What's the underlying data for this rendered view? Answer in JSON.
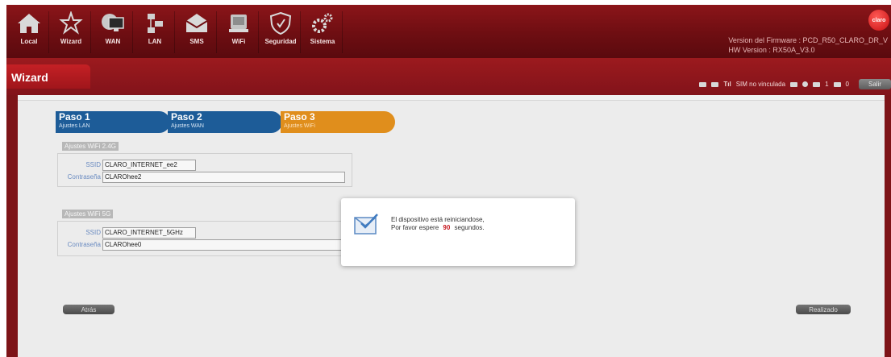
{
  "nav": {
    "items": [
      {
        "label": "Local",
        "icon": "home-icon"
      },
      {
        "label": "Wizard",
        "icon": "wizard-icon"
      },
      {
        "label": "WAN",
        "icon": "monitor-icon"
      },
      {
        "label": "LAN",
        "icon": "lan-icon"
      },
      {
        "label": "SMS",
        "icon": "envelope-icon"
      },
      {
        "label": "WiFi",
        "icon": "wifi-icon"
      },
      {
        "label": "Seguridad",
        "icon": "shield-icon"
      },
      {
        "label": "Sistema",
        "icon": "gears-icon"
      }
    ]
  },
  "header": {
    "firmware": "Version del Firmware : PCD_R50_CLARO_DR_V",
    "hw": "HW Version : RX50A_V3.0",
    "logo": "claro"
  },
  "titlebar": {
    "title": "Wizard",
    "sim_status": "SIM no vinculada",
    "count_a": "1",
    "count_b": "0",
    "logout": "Salir"
  },
  "steps": [
    {
      "title": "Paso 1",
      "subtitle": "Ajustes LAN"
    },
    {
      "title": "Paso 2",
      "subtitle": "Ajustes WAN"
    },
    {
      "title": "Paso 3",
      "subtitle": "Ajustes WiFi"
    }
  ],
  "wifi24": {
    "title": "Ajustes WiFi 2.4G",
    "ssid_label": "SSID",
    "ssid": "CLARO_INTERNET_ee2",
    "password_label": "Contraseña",
    "password": "CLAROhee2"
  },
  "wifi5": {
    "title": "Ajustes WiFi 5G",
    "ssid_label": "SSID",
    "ssid": "CLARO_INTERNET_5GHz",
    "password_label": "Contraseña",
    "password": "CLAROhee0"
  },
  "buttons": {
    "back": "Atrás",
    "done": "Realizado"
  },
  "modal": {
    "line1": "El dispositivo está reiniciandose,",
    "line2_prefix": "Por favor espere",
    "seconds": "90",
    "line2_suffix": "segundos."
  },
  "colors": {
    "header": "#6e0e12",
    "step_blue": "#1d5c98",
    "step_orange": "#e08e1c",
    "countdown": "#c7161d"
  }
}
